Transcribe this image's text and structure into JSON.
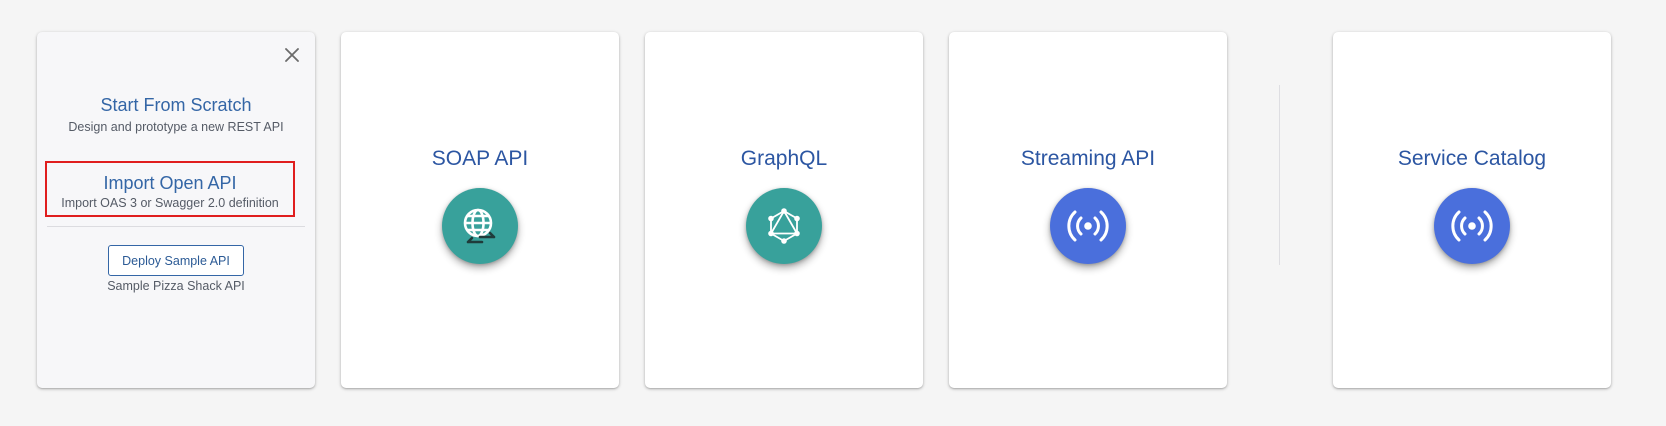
{
  "rest_card": {
    "close_icon": "close-icon",
    "start_from_scratch": {
      "title": "Start From Scratch",
      "description": "Design and prototype a new REST API"
    },
    "import_open_api": {
      "title": "Import Open API",
      "description": "Import OAS 3 or Swagger 2.0 definition"
    },
    "deploy_sample": {
      "button_label": "Deploy Sample API",
      "description": "Sample Pizza Shack API"
    }
  },
  "api_types": [
    {
      "title": "SOAP API",
      "icon": "globe-exchange-icon",
      "icon_color": "#38a19b"
    },
    {
      "title": "GraphQL",
      "icon": "graphql-icon",
      "icon_color": "#38a19b"
    },
    {
      "title": "Streaming API",
      "icon": "broadcast-icon",
      "icon_color": "#4a6fdc"
    },
    {
      "title": "Service Catalog",
      "icon": "broadcast-icon",
      "icon_color": "#4a6fdc"
    }
  ],
  "colors": {
    "background": "#f5f5f5",
    "link_blue": "#3466a6",
    "highlight_border": "#e01e1e",
    "teal": "#38a19b",
    "blue": "#4a6fdc"
  }
}
